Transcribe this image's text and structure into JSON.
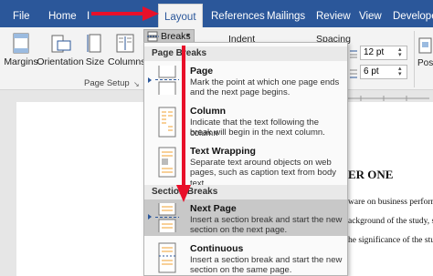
{
  "tabs": [
    {
      "label": "File"
    },
    {
      "label": "Home"
    },
    {
      "label": "I"
    },
    {
      "label": "Layout"
    },
    {
      "label": "References"
    },
    {
      "label": "Mailings"
    },
    {
      "label": "Review"
    },
    {
      "label": "View"
    },
    {
      "label": "Developer"
    }
  ],
  "ribbon": {
    "margins": "Margins",
    "orientation": "Orientation",
    "size": "Size",
    "columns": "Columns",
    "breaks": "Breaks",
    "indent": "Indent",
    "spacing": "Spacing",
    "spacing_before_value": "12 pt",
    "spacing_after_value": "6 pt",
    "pos_label": "Pos",
    "page_setup_label": "Page Setup"
  },
  "menu": {
    "page_breaks_header": "Page Breaks",
    "section_breaks_header": "Section Breaks",
    "items": [
      {
        "title": "Page",
        "desc1": "Mark the point at which one page ends",
        "desc2": "and the next page begins.",
        "desc3": ""
      },
      {
        "title": "Column",
        "desc1": "Indicate that the text following the column",
        "desc2": "break will begin in the next column.",
        "desc3": ""
      },
      {
        "title": "Text Wrapping",
        "desc1": "Separate text around objects on web",
        "desc2": "pages, such as caption text from body text.",
        "desc3": ""
      },
      {
        "title": "Next Page",
        "desc1": "Insert a section break and start the new",
        "desc2": "section on the next page.",
        "desc3": ""
      },
      {
        "title": "Continuous",
        "desc1": "Insert a section break and start the new",
        "desc2": "section on the same page.",
        "desc3": ""
      }
    ]
  },
  "document": {
    "heading": "ER ONE",
    "line1": "ware on business perform",
    "line2": "ackground of the study, state",
    "line3": "he significance of the study."
  },
  "colors": {
    "accent": "#2b579a",
    "arrow": "#e8102a",
    "highlight": "#c8c8c8"
  }
}
